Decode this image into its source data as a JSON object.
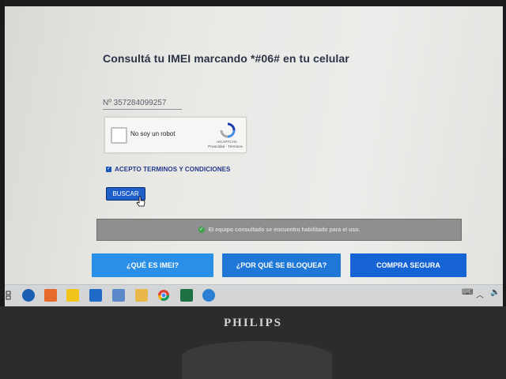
{
  "page": {
    "title": "Consultá tu IMEI marcando *#06# en tu celular",
    "imei_value": "Nº 357284099257",
    "recaptcha": {
      "label": "No soy un robot",
      "brand": "reCAPTCHA",
      "links": "Privacidad - Términos"
    },
    "terms_label": "ACEPTO TERMINOS Y CONDICIONES",
    "search_button": "BUSCAR",
    "status_message": "El equipo consultado se encuentra habilitado para el uso.",
    "nav_buttons": {
      "what_is_imei": "¿QUÉ ES IMEI?",
      "why_blocked": "¿POR QUÉ SE BLOQUEA?",
      "secure_purchase": "COMPRA SEGURA"
    }
  },
  "taskbar": {
    "icons": [
      "search-icon",
      "calendar-icon",
      "sticky-notes-icon",
      "mail-icon",
      "document-icon",
      "file-explorer-icon",
      "chrome-icon",
      "excel-icon",
      "teamviewer-icon"
    ],
    "tray_icons": [
      "keyboard-icon",
      "chevron-up-icon",
      "speaker-icon"
    ]
  },
  "monitor": {
    "brand": "PHILIPS"
  },
  "colors": {
    "accent_blue": "#1563d4",
    "status_gray": "#8e908f",
    "title_color": "#2c3447"
  }
}
